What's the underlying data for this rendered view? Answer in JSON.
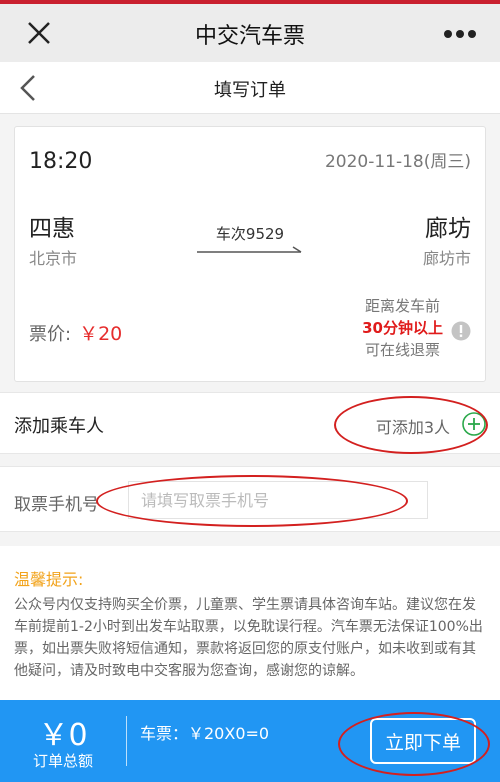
{
  "topbar": {
    "title": "中交汽车票"
  },
  "navbar": {
    "title": "填写订单"
  },
  "ticket": {
    "time": "18:20",
    "date": "2020-11-18(周三)",
    "from_station": "四惠",
    "from_city": "北京市",
    "to_station": "廊坊",
    "to_city": "廊坊市",
    "train_no": "车次9529",
    "price_label": "票价:",
    "price_value": "￥20",
    "refund_line1": "距离发车前",
    "refund_line2": "30分钟以上",
    "refund_line3": "可在线退票"
  },
  "passenger": {
    "label": "添加乘车人",
    "hint": "可添加3人"
  },
  "phone": {
    "label": "取票手机号",
    "placeholder": "请填写取票手机号",
    "value": ""
  },
  "tips": {
    "title": "温馨提示:",
    "text": "公众号内仅支持购买全价票，儿童票、学生票请具体咨询车站。建议您在发车前提前1-2小时到出发车站取票，以免耽误行程。汽车票无法保证100%出票，如出票失败将短信通知，票款将返回您的原支付账户，如未收到或有其他疑问，请及时致电中交客服为您查询，感谢您的谅解。"
  },
  "bottom": {
    "amount": "￥0",
    "amount_label": "订单总额",
    "breakdown": "车票：￥20X0=0",
    "order_button": "立即下单"
  },
  "colors": {
    "accent": "#2196f3",
    "price_red": "#e62d2d",
    "tips_orange": "#f2a31b",
    "annotation_red": "#d3201f",
    "plus_green": "#2aa84a"
  },
  "icons": [
    "close-icon",
    "more-icon",
    "back-chevron-icon",
    "arrow-right-icon",
    "info-icon",
    "plus-circle-icon"
  ]
}
